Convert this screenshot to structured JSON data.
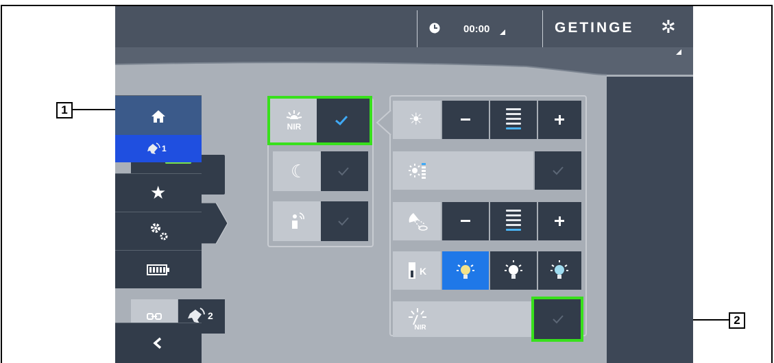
{
  "callouts": {
    "one": "1",
    "two": "2"
  },
  "header": {
    "time": "00:00",
    "brand": "GETINGE",
    "brand_symbol": "✲"
  },
  "left": {
    "light_head_number": "1",
    "camera_number": "1",
    "sync_head_number": "2"
  },
  "sidebar": {
    "active_head_number": "1"
  },
  "colors": {
    "accent": "#1f78e8",
    "highlight": "#38e01c",
    "indicator": "#7be24a",
    "button": "#323c4a"
  }
}
